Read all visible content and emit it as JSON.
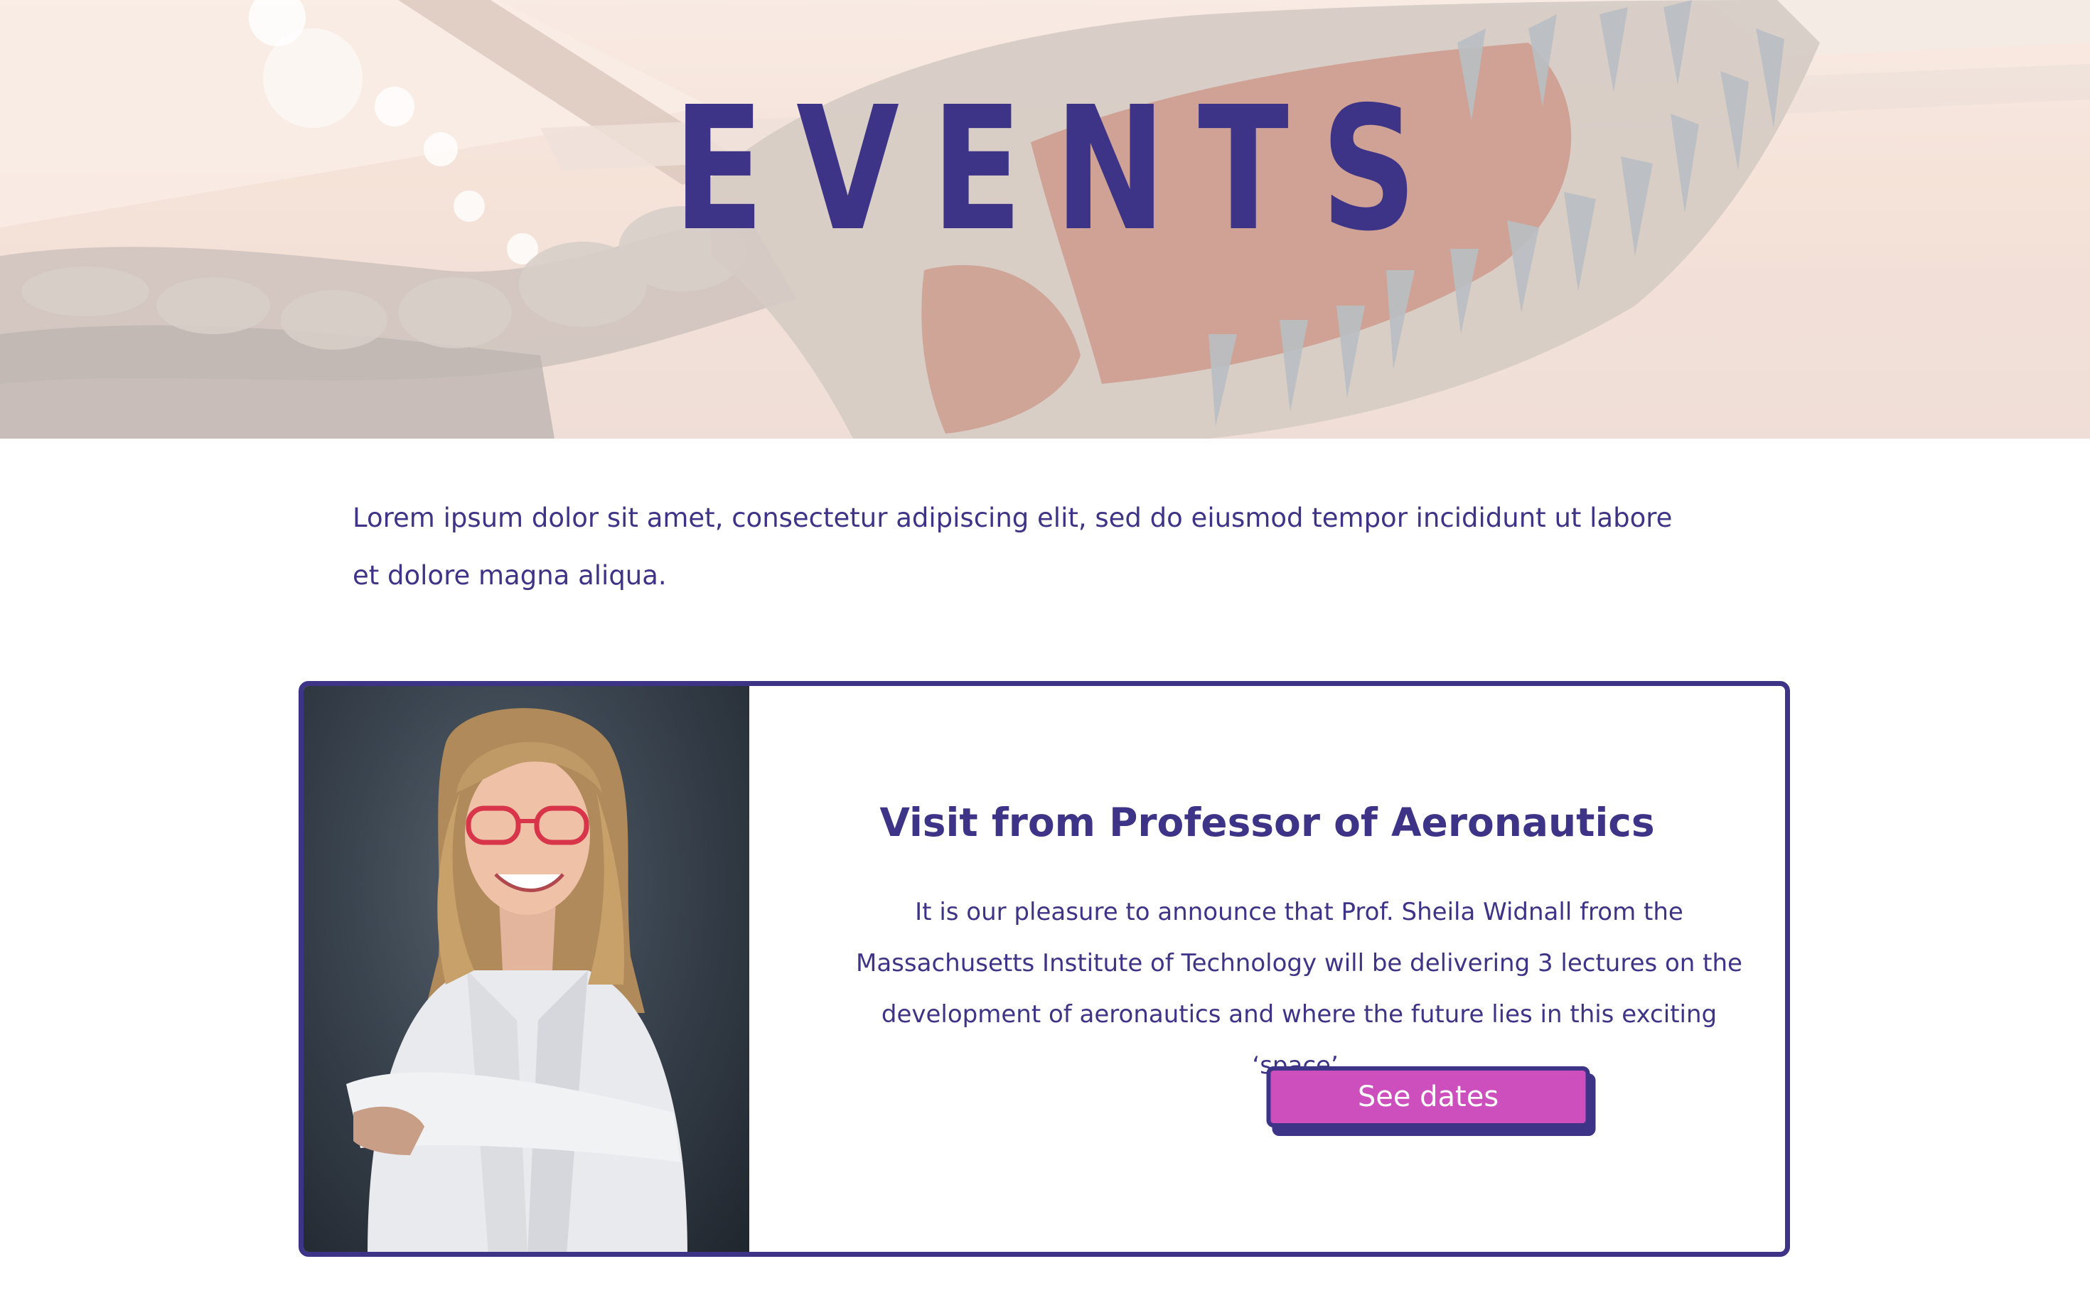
{
  "hero": {
    "title": "EVENTS",
    "image": "dinosaur-skeleton-photo"
  },
  "intro": {
    "text": "Lorem ipsum dolor sit amet, consectetur adipiscing elit, sed do eiusmod tempor incididunt ut labore et dolore magna aliqua."
  },
  "event_card": {
    "image": "professor-portrait-photo",
    "title": "Visit from Professor of Aeronautics",
    "description": "It is our pleasure to announce that Prof. Sheila Widnall from the Massachusetts Institute of Technology will be delivering 3 lectures on the development of aeronautics and where the future lies in this exciting ‘space’.",
    "button_label": "See dates"
  },
  "colors": {
    "primary": "#3d3488",
    "accent": "#cc4fbd",
    "background": "#ffffff"
  }
}
